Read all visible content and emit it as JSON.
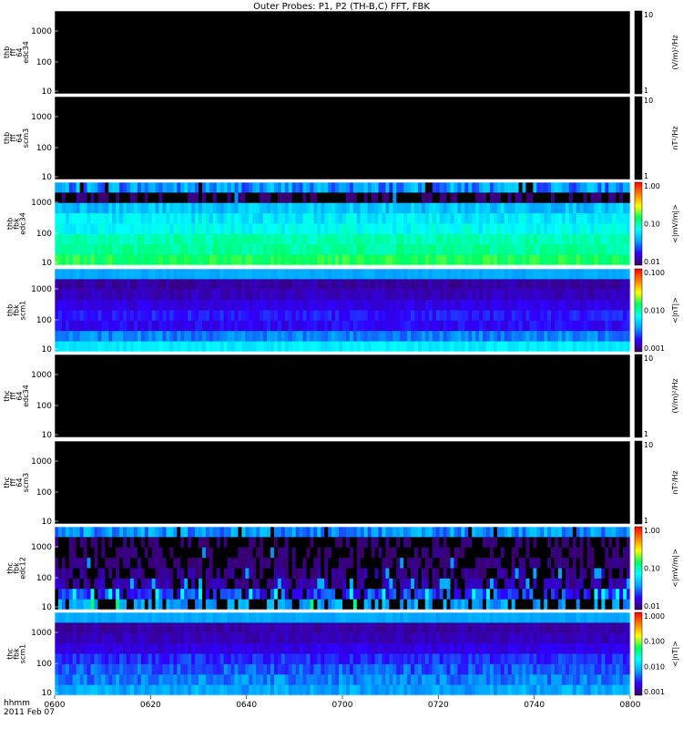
{
  "title": "Outer Probes: P1, P2 (TH-B,C) FFT, FBK",
  "time_axis": {
    "ticks": [
      "0600",
      "0620",
      "0640",
      "0700",
      "0720",
      "0740",
      "0800"
    ],
    "label_line1": "hhmm",
    "label_line2": "2011 Feb 07"
  },
  "colors": {
    "background": "#000000",
    "frame": "#ffffff",
    "colorbar_stops": [
      "#3a0060",
      "#3000ff",
      "#00a0ff",
      "#00ffff",
      "#00ff60",
      "#ffff00",
      "#ff8000",
      "#ff0000"
    ]
  },
  "chart_data": [
    {
      "type": "heatmap",
      "name_lines": [
        "thb",
        "fff",
        "64",
        "edc34"
      ],
      "yticks": [
        "1000",
        "100",
        "10"
      ],
      "cb_unit": "(V/m)²/Hz",
      "cb_ticks": [
        "10",
        "1"
      ],
      "colorbar": "black",
      "bands": []
    },
    {
      "type": "heatmap",
      "name_lines": [
        "thb",
        "fff",
        "64",
        "scm3"
      ],
      "yticks": [
        "1000",
        "100",
        "10"
      ],
      "cb_unit": "nT²/Hz",
      "cb_ticks": [
        "10",
        "1"
      ],
      "colorbar": "black",
      "bands": []
    },
    {
      "type": "heatmap",
      "name_lines": [
        "thb",
        "fbk",
        "edc34"
      ],
      "yticks": [
        "1000",
        "100",
        "10"
      ],
      "cb_unit": "<|mV/m|>",
      "cb_ticks": [
        "1.00",
        "0.10",
        "0.01"
      ],
      "colorbar": "rainbow",
      "bands": [
        {
          "level": 0.28,
          "var": 0.1,
          "stripe": 0.92
        },
        {
          "level": 0.02,
          "var": 0.02,
          "stripe": 0.05
        },
        {
          "level": 0.34,
          "var": 0.06,
          "stripe": 0.0
        },
        {
          "level": 0.4,
          "var": 0.06,
          "stripe": 0.0
        },
        {
          "level": 0.43,
          "var": 0.05,
          "stripe": 0.0
        },
        {
          "level": 0.5,
          "var": 0.04,
          "stripe": 0.0
        },
        {
          "level": 0.52,
          "var": 0.04,
          "stripe": 0.0
        },
        {
          "level": 0.58,
          "var": 0.04,
          "stripe": 0.0
        }
      ]
    },
    {
      "type": "heatmap",
      "name_lines": [
        "thb",
        "fbk",
        "scm1"
      ],
      "yticks": [
        "1000",
        "100",
        "10"
      ],
      "cb_unit": "<|nT|>",
      "cb_ticks": [
        "0.100",
        "0.010",
        "0.001"
      ],
      "colorbar": "rainbow",
      "bands": [
        {
          "level": 0.3,
          "var": 0.02,
          "stripe": 0.0
        },
        {
          "level": 0.06,
          "var": 0.03,
          "stripe": 0.0
        },
        {
          "level": 0.08,
          "var": 0.03,
          "stripe": 0.0
        },
        {
          "level": 0.12,
          "var": 0.03,
          "stripe": 0.0
        },
        {
          "level": 0.16,
          "var": 0.04,
          "stripe": 0.0
        },
        {
          "level": 0.14,
          "var": 0.04,
          "stripe": 0.0
        },
        {
          "level": 0.26,
          "var": 0.05,
          "stripe": 0.0
        },
        {
          "level": 0.4,
          "var": 0.03,
          "stripe": 0.0
        }
      ]
    },
    {
      "type": "heatmap",
      "name_lines": [
        "thc",
        "fff",
        "64",
        "edc34"
      ],
      "yticks": [
        "1000",
        "100",
        "10"
      ],
      "cb_unit": "(V/m)²/Hz",
      "cb_ticks": [
        "10",
        "1"
      ],
      "colorbar": "black",
      "bands": []
    },
    {
      "type": "heatmap",
      "name_lines": [
        "thc",
        "fff",
        "64",
        "scm3"
      ],
      "yticks": [
        "1000",
        "100",
        "10"
      ],
      "cb_unit": "nT²/Hz",
      "cb_ticks": [
        "10",
        "1"
      ],
      "colorbar": "black",
      "bands": []
    },
    {
      "type": "heatmap",
      "name_lines": [
        "thc",
        "fbk",
        "edc12"
      ],
      "yticks": [
        "1000",
        "100",
        "10"
      ],
      "cb_unit": "<|mV/m|>",
      "cb_ticks": [
        "1.00",
        "0.10",
        "0.01"
      ],
      "colorbar": "rainbow",
      "bands": [
        {
          "level": 0.28,
          "var": 0.08,
          "stripe": 0.95
        },
        {
          "level": 0.02,
          "var": 0.02,
          "stripe": 0.1
        },
        {
          "level": 0.02,
          "var": 0.02,
          "stripe": 0.05
        },
        {
          "level": 0.03,
          "var": 0.02,
          "stripe": 0.1
        },
        {
          "level": 0.04,
          "var": 0.04,
          "stripe": 0.3
        },
        {
          "level": 0.06,
          "var": 0.05,
          "stripe": 0.4
        },
        {
          "level": 0.18,
          "var": 0.1,
          "stripe": 0.5
        },
        {
          "level": 0.3,
          "var": 0.06,
          "stripe": 0.2
        }
      ]
    },
    {
      "type": "heatmap",
      "name_lines": [
        "thc",
        "fbk",
        "scm1"
      ],
      "yticks": [
        "1000",
        "100",
        "10"
      ],
      "cb_unit": "<|nT|>",
      "cb_ticks": [
        "1.000",
        "0.100",
        "0.010",
        "0.001"
      ],
      "colorbar": "rainbow",
      "bands": [
        {
          "level": 0.3,
          "var": 0.02,
          "stripe": 0.0
        },
        {
          "level": 0.06,
          "var": 0.03,
          "stripe": 0.0
        },
        {
          "level": 0.08,
          "var": 0.03,
          "stripe": 0.0
        },
        {
          "level": 0.12,
          "var": 0.03,
          "stripe": 0.0
        },
        {
          "level": 0.18,
          "var": 0.05,
          "stripe": 0.0
        },
        {
          "level": 0.22,
          "var": 0.06,
          "stripe": 0.0
        },
        {
          "level": 0.26,
          "var": 0.06,
          "stripe": 0.0
        },
        {
          "level": 0.3,
          "var": 0.05,
          "stripe": 0.0
        }
      ]
    }
  ]
}
